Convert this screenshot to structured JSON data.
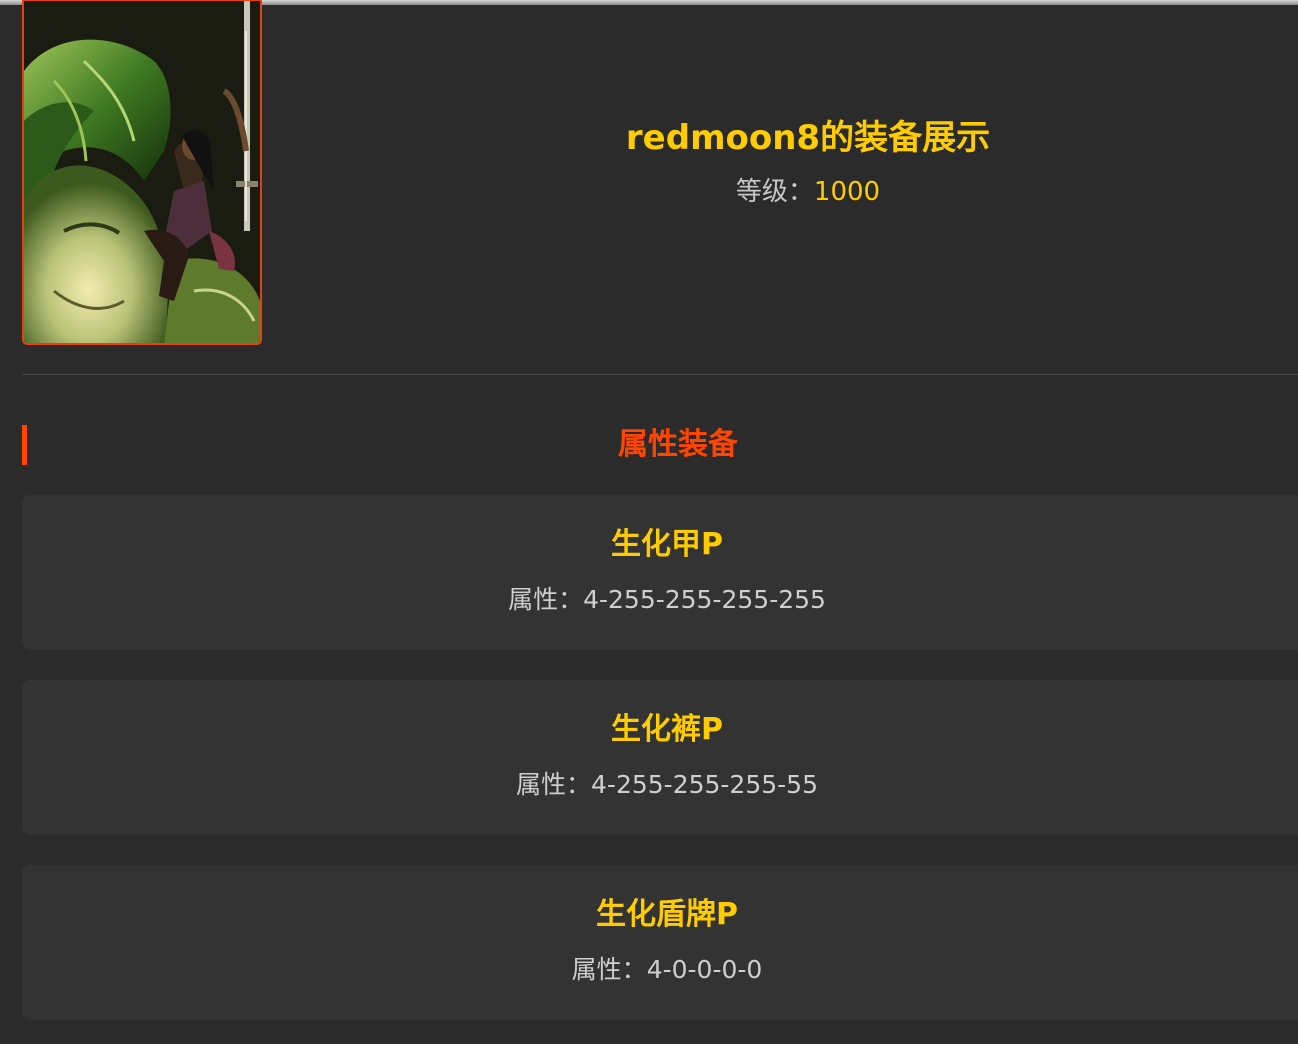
{
  "profile": {
    "title": "redmoon8的装备展示",
    "level_label": "等级：",
    "level_value": "1000"
  },
  "section": {
    "title": "属性装备"
  },
  "items": [
    {
      "name": "生化甲P",
      "attr_label": "属性：",
      "attr_value": "4-255-255-255-255"
    },
    {
      "name": "生化裤P",
      "attr_label": "属性：",
      "attr_value": "4-255-255-255-55"
    },
    {
      "name": "生化盾牌P",
      "attr_label": "属性：",
      "attr_value": "4-0-0-0-0"
    }
  ],
  "colors": {
    "background": "#2b2b2b",
    "card": "#333333",
    "gold": "#ffcc00",
    "accent": "#ff4500",
    "text": "#cfcfcf"
  },
  "icons": {
    "avatar": "character-portrait"
  }
}
